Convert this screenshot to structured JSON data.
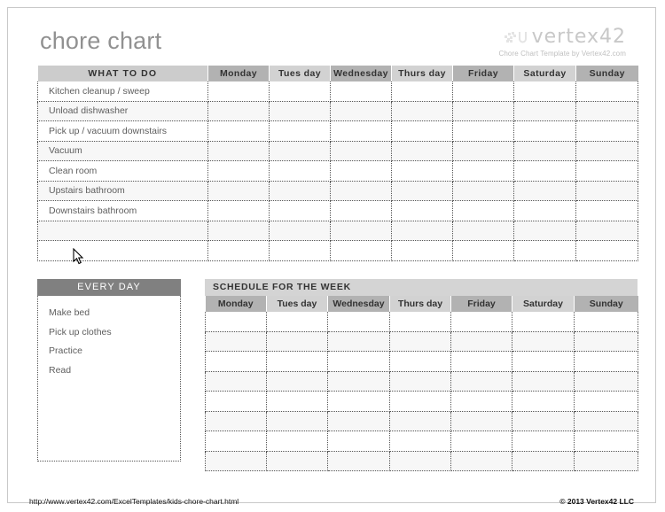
{
  "page": {
    "title": "chore chart"
  },
  "brand": {
    "logo_icon": "vertex42-logo-icon",
    "word": "vertex42",
    "subtitle": "Chore Chart Template by Vertex42.com"
  },
  "chore_table": {
    "task_column_header": "WHAT TO DO",
    "day_headers": [
      "Monday",
      "Tues day",
      "Wednesday",
      "Thurs day",
      "Friday",
      "Saturday",
      "Sunday"
    ],
    "day_header_shades": [
      "dark",
      "light",
      "dark",
      "light",
      "dark",
      "light",
      "dark"
    ],
    "tasks": [
      "Kitchen cleanup / sweep",
      "Unload dishwasher",
      "Pick up / vacuum downstairs",
      "Vacuum",
      "Clean room",
      "Upstairs bathroom",
      "Downstairs bathroom",
      "",
      ""
    ]
  },
  "everyday": {
    "header": "EVERY DAY",
    "items": [
      "Make bed",
      "Pick up clothes",
      "Practice",
      "Read"
    ]
  },
  "schedule": {
    "title": "SCHEDULE FOR THE WEEK",
    "day_headers": [
      "Monday",
      "Tues day",
      "Wednesday",
      "Thurs day",
      "Friday",
      "Saturday",
      "Sunday"
    ],
    "day_header_shades": [
      "dark",
      "light",
      "dark",
      "light",
      "dark",
      "light",
      "dark"
    ],
    "row_count": 8
  },
  "footer": {
    "url": "http://www.vertex42.com/ExcelTemplates/kids-chore-chart.html",
    "copyright": "© 2013 Vertex42 LLC"
  },
  "cursor": {
    "icon": "mouse-pointer-icon"
  },
  "colors": {
    "title_gray": "#919191",
    "header_dark": "#b2b2b2",
    "header_light": "#d2d2d2",
    "task_header": "#cccccc",
    "everyday_header": "#808080",
    "schedule_title_bg": "#d4d4d4",
    "band_gray": "#f7f7f7",
    "text_gray": "#5e5e5e"
  }
}
